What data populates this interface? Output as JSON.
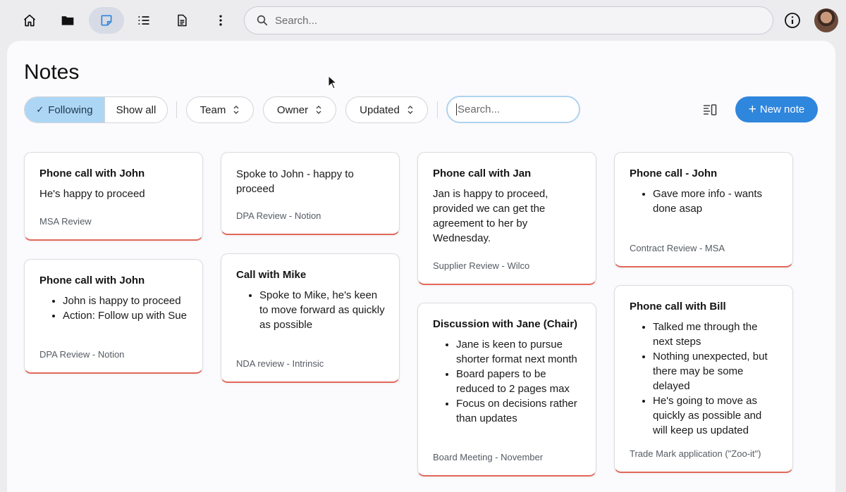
{
  "toolbar": {
    "icons": [
      "home-icon",
      "folder-icon",
      "note-icon",
      "list-icon",
      "document-icon",
      "more-icon"
    ],
    "active": "note-icon",
    "search_placeholder": "Search..."
  },
  "page": {
    "title": "Notes"
  },
  "filters": {
    "following_label": "Following",
    "show_all_label": "Show all",
    "team_label": "Team",
    "owner_label": "Owner",
    "updated_label": "Updated",
    "search_placeholder": "Search...",
    "new_note_label": "New note"
  },
  "notes": [
    {
      "title": "Phone call with John",
      "body": "He's happy to proceed",
      "bullets": [],
      "tag": "MSA Review"
    },
    {
      "title": "Phone call with John",
      "body": "",
      "bullets": [
        "John is happy to proceed",
        "Action: Follow up with Sue"
      ],
      "tag": "DPA Review - Notion"
    },
    {
      "title": "",
      "body": "Spoke to John - happy to proceed",
      "bullets": [],
      "tag": "DPA Review - Notion"
    },
    {
      "title": "Call with Mike",
      "body": "",
      "bullets": [
        "Spoke to Mike, he's keen to move forward as quickly as possible"
      ],
      "tag": "NDA review - Intrinsic"
    },
    {
      "title": "Phone call with Jan",
      "body": "Jan is happy to proceed, provided we can get the agreement to her by Wednesday.",
      "bullets": [],
      "tag": "Supplier Review - Wilco"
    },
    {
      "title": "Discussion with Jane (Chair)",
      "body": "",
      "bullets": [
        "Jane is keen to pursue shorter format next month",
        "Board papers to be reduced to 2 pages max",
        "Focus on decisions rather than updates"
      ],
      "tag": "Board Meeting - November"
    },
    {
      "title": "Phone call - John",
      "body": "",
      "bullets": [
        "Gave more info - wants done asap"
      ],
      "tag": "Contract Review - MSA"
    },
    {
      "title": "Phone call with Bill",
      "body": "",
      "bullets": [
        "Talked me through the next steps",
        "Nothing unexpected, but there may be some delayed",
        "He's going to move as quickly as possible and will keep us updated"
      ],
      "tag": "Trade Mark application (\"Zoo-it\")"
    }
  ]
}
